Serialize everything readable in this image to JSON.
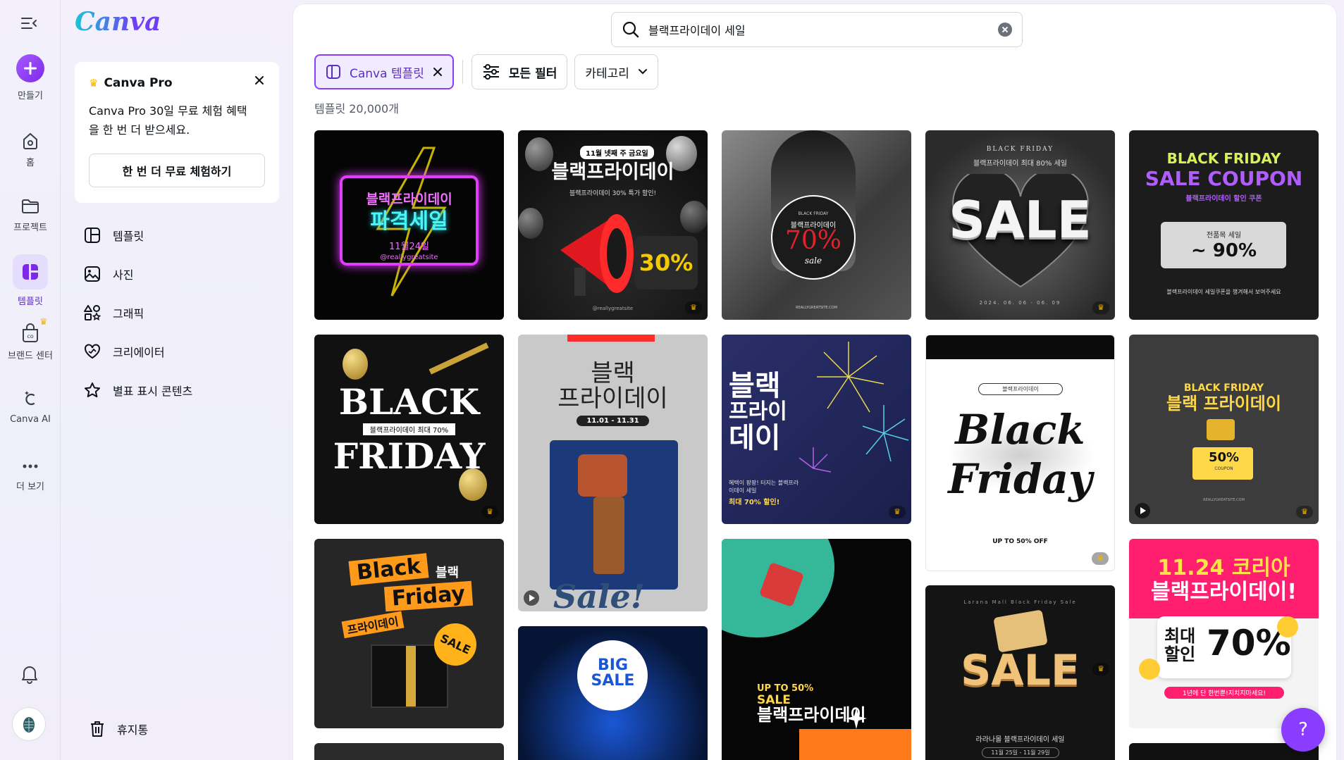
{
  "rail": {
    "create_label": "만들기",
    "home_label": "홈",
    "projects_label": "프로젝트",
    "templates_label": "템플릿",
    "brand_label": "브랜드 센터",
    "ai_label": "Canva AI",
    "more_label": "더 보기"
  },
  "panel": {
    "logo": "Canva",
    "promo": {
      "title": "Canva Pro",
      "body": "Canva Pro 30일 무료 체험 혜택을 한 번 더 받으세요.",
      "button": "한 번 더 무료 체험하기"
    },
    "nav": [
      {
        "label": "템플릿",
        "icon": "template-icon"
      },
      {
        "label": "사진",
        "icon": "photo-icon"
      },
      {
        "label": "그래픽",
        "icon": "graphics-icon"
      },
      {
        "label": "크리에이터",
        "icon": "creator-icon"
      },
      {
        "label": "별표 표시 콘텐츠",
        "icon": "star-icon"
      }
    ],
    "trash_label": "휴지통"
  },
  "search": {
    "value": "블랙프라이데이 세일"
  },
  "filters": {
    "chip_active": "Canva 템플릿",
    "all_filters": "모든 필터",
    "category": "카테고리"
  },
  "results_count": "템플릿 20,000개",
  "templates": [
    {
      "lines": [
        "블랙프라이데이",
        "파격세일",
        "11월24일",
        "@reallygreatsite"
      ]
    },
    {
      "lines": [
        "11월 넷째 주 금요일",
        "블랙프라이데이",
        "블랙프라이데이 30% 특가 할인!",
        "30%",
        "@reallygreatsite"
      ]
    },
    {
      "lines": [
        "BLACK FRIDAY",
        "블랙프라이데이",
        "70%",
        "sale",
        "REALLYGREATSITE.COM"
      ]
    },
    {
      "lines": [
        "BLACK FRIDAY",
        "블랙프라이데이 최대 80% 세일",
        "SALE",
        "2024. 06. 06 - 06. 09"
      ]
    },
    {
      "lines": [
        "BLACK FRIDAY",
        "SALE COUPON",
        "블랙프라이데이 할인 쿠폰",
        "전품목 세일",
        "~ 90%",
        "블랙프라이데이 세일쿠폰을 챙겨해서 보여주세요"
      ]
    },
    {
      "lines": [
        "BLACK",
        "블랙프라이데이 최대 70%",
        "FRIDAY"
      ]
    },
    {
      "lines": [
        "블랙",
        "프라이데이",
        "11.01 - 11.31",
        "Sale!"
      ]
    },
    {
      "lines": [
        "블랙",
        "프라이",
        "데이",
        "혜택이 팡팡! 터지는 블랙프라이데이 세일",
        "최대 70% 할인!"
      ]
    },
    {
      "lines": [
        "블랙프라이데이",
        "Black",
        "Friday",
        "UP TO 50% OFF"
      ]
    },
    {
      "lines": [
        "BLACK FRIDAY",
        "블랙 프라이데이",
        "50%",
        "COUPON",
        "REALLYGREATSITE.COM"
      ]
    },
    {
      "lines": [
        "Black",
        "블랙",
        "Friday",
        "프라이데이",
        "SALE"
      ]
    },
    {
      "lines": [
        "BIG",
        "SALE"
      ]
    },
    {
      "lines": [
        "UP TO 50%",
        "SALE",
        "블랙프라이데이"
      ]
    },
    {
      "lines": [
        "Larana Mall Black Friday Sale",
        "SALE",
        "라라나몰 블랙프라이데이 세일",
        "11월 25일 - 11월 29일"
      ]
    },
    {
      "lines": [
        "11.24 코리아",
        "블랙프라이데이!",
        "최대",
        "할인",
        "70%",
        "1년에 단 한번뿐!지치지마세요!"
      ]
    }
  ],
  "help_label": "?",
  "colors": {
    "accent": "#8b3dff",
    "crown": "#f6b300"
  }
}
